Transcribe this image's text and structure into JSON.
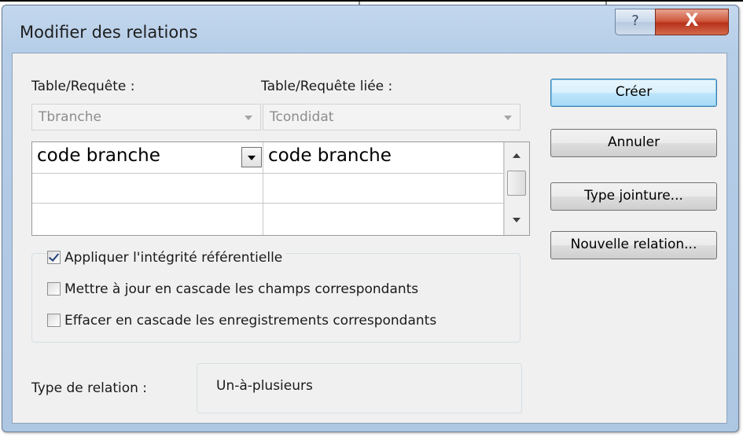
{
  "window": {
    "title": "Modifier des relations",
    "help_glyph": "?",
    "close_glyph": "X"
  },
  "table_query": {
    "label": "Table/Requête :",
    "value": "Tbranche"
  },
  "related_table_query": {
    "label": "Table/Requête liée :",
    "value": "Tcondidat"
  },
  "fields_grid": {
    "rows": [
      {
        "left": "code branche",
        "right": "code branche"
      },
      {
        "left": "",
        "right": ""
      },
      {
        "left": "",
        "right": ""
      }
    ]
  },
  "options": {
    "enforce_integrity": {
      "label": "Appliquer l'intégrité référentielle",
      "checked": true
    },
    "cascade_update": {
      "label": "Mettre à jour en cascade les champs correspondants",
      "checked": false
    },
    "cascade_delete": {
      "label": "Effacer en cascade les enregistrements correspondants",
      "checked": false
    }
  },
  "relation_type": {
    "label": "Type de relation :",
    "value": "Un-à-plusieurs"
  },
  "buttons": {
    "create": "Créer",
    "cancel": "Annuler",
    "join_type": "Type jointure...",
    "new_relation": "Nouvelle relation..."
  }
}
